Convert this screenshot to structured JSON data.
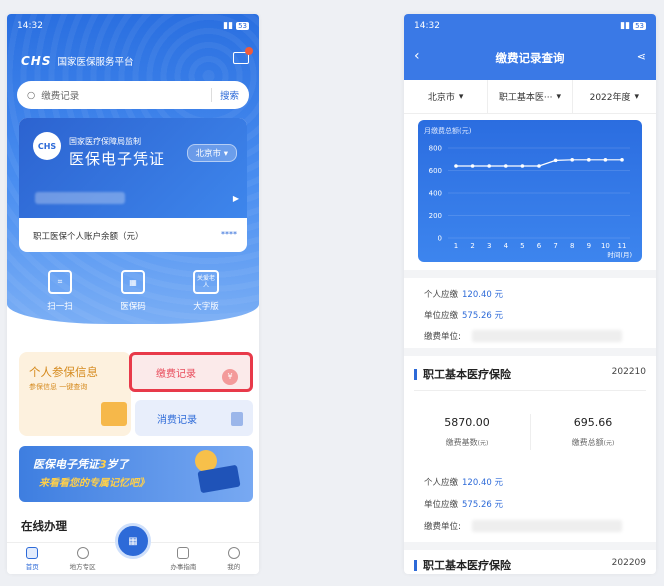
{
  "left": {
    "status_time": "14:32",
    "battery": "53",
    "brand_logo": "CHS",
    "brand_name": "国家医保服务平台",
    "search_placeholder": "缴费记录",
    "search_button": "搜索",
    "card": {
      "logo": "CHS",
      "supervisor": "国家医疗保障局监制",
      "title": "医保电子凭证",
      "city": "北京市",
      "balance_label": "职工医保个人账户余额（元）",
      "masked": "****"
    },
    "quick": [
      {
        "label": "扫一扫",
        "icon": "scan-icon"
      },
      {
        "label": "医保码",
        "icon": "qrcode-icon"
      },
      {
        "label": "大字版",
        "icon": "elderly-icon",
        "icon_text": "关爱老人"
      }
    ],
    "info_title": "个人参保信息",
    "info_sub": "参保信息 一键查询",
    "payment_records": "缴费记录",
    "consume_records": "消费记录",
    "banner_line1a": "医保电子凭证",
    "banner_num": "3",
    "banner_line1b": "岁了",
    "banner_line2": "来看看您的专属记忆吧》",
    "online": "在线办理",
    "tabs": [
      "首页",
      "地方专区",
      "",
      "办事指南",
      "我的"
    ]
  },
  "right": {
    "status_time": "14:32",
    "battery": "53",
    "title": "缴费记录查询",
    "filters": [
      "北京市",
      "职工基本医···",
      "2022年度"
    ],
    "monthly_payable_1": "120.40 元",
    "unit_payable_1": "575.26 元",
    "labels": {
      "personal": "个人应缴",
      "unit": "单位应缴",
      "org": "缴费单位:"
    },
    "section_title": "职工基本医疗保险",
    "date_1": "202210",
    "base_value": "5870.00",
    "base_label": "缴费基数",
    "total_value": "695.66",
    "total_label": "缴费总额",
    "yuan_unit": "(元)",
    "personal_2": "120.40 元",
    "unit_2": "575.26 元",
    "date_2": "202209"
  },
  "chart_data": {
    "type": "line",
    "title": "月缴费总额(元)",
    "xlabel": "时间(月)",
    "ylabel": "",
    "x": [
      1,
      2,
      3,
      4,
      5,
      6,
      7,
      8,
      9,
      10,
      11
    ],
    "series": [
      {
        "values": [
          640,
          640,
          640,
          640,
          640,
          640,
          690,
          695,
          695,
          695,
          695
        ]
      }
    ],
    "ylim": [
      0,
      800
    ],
    "yticks": [
      0,
      200,
      400,
      600,
      800
    ],
    "grid": true,
    "colors": {
      "line": "#ffffff",
      "background": "#3a79e6"
    }
  }
}
